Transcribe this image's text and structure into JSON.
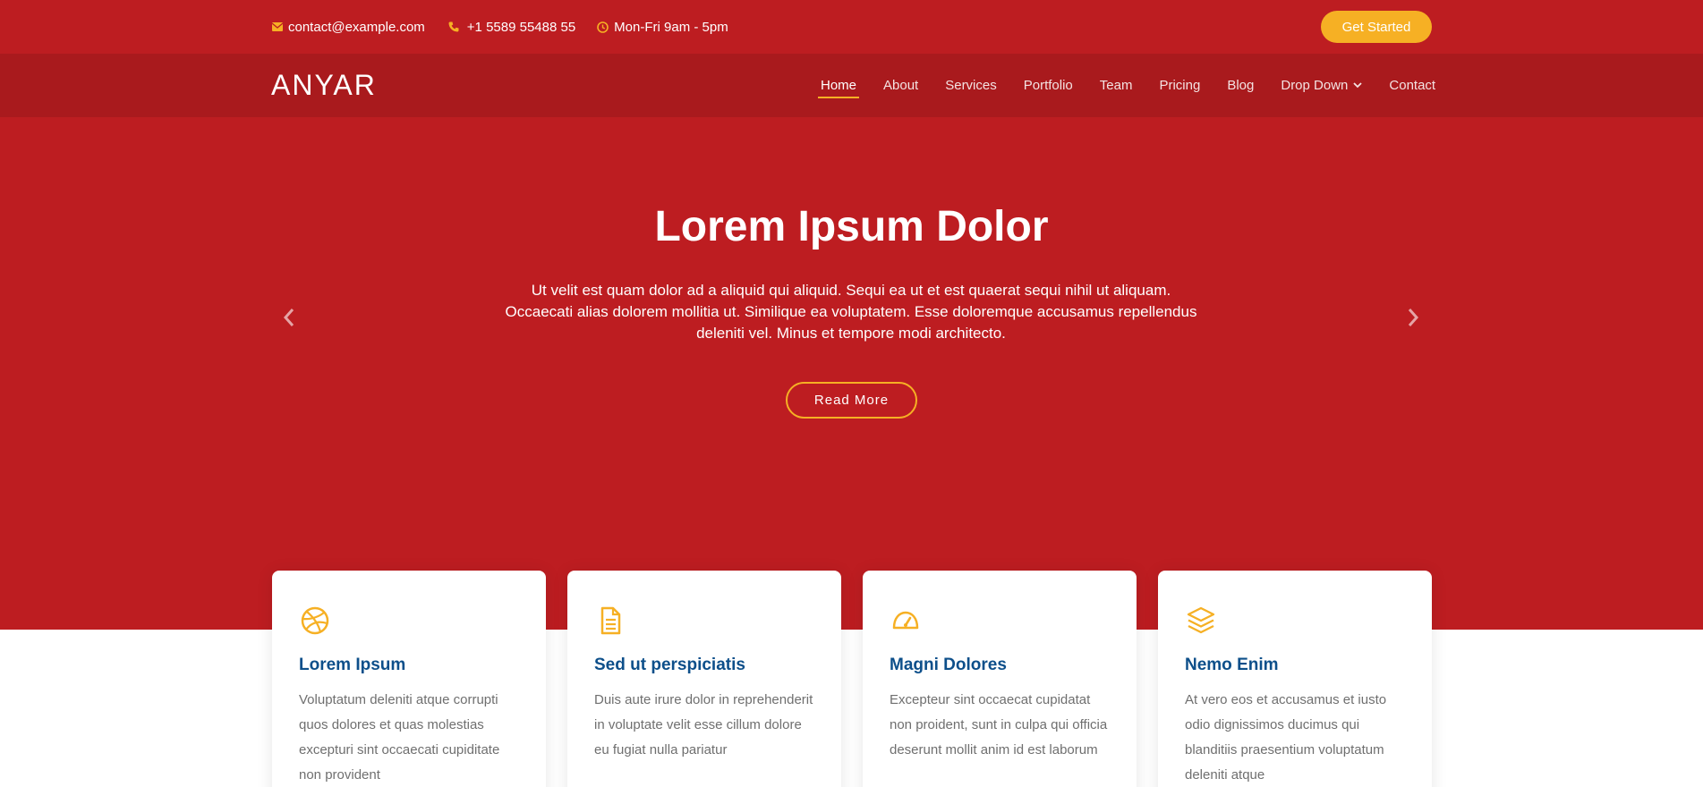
{
  "topbar": {
    "email": "contact@example.com",
    "phone": "+1 5589 55488 55",
    "hours": "Mon-Fri 9am - 5pm",
    "cta_label": "Get Started",
    "icons": [
      "envelope-icon",
      "phone-icon",
      "clock-icon"
    ]
  },
  "header": {
    "logo": "ANYAR",
    "nav": [
      {
        "label": "Home",
        "active": true
      },
      {
        "label": "About"
      },
      {
        "label": "Services"
      },
      {
        "label": "Portfolio"
      },
      {
        "label": "Team"
      },
      {
        "label": "Pricing"
      },
      {
        "label": "Blog"
      },
      {
        "label": "Drop Down",
        "has_dropdown": true
      },
      {
        "label": "Contact"
      }
    ]
  },
  "hero": {
    "title": "Lorem Ipsum Dolor",
    "text": "Ut velit est quam dolor ad a aliquid qui aliquid. Sequi ea ut et est quaerat sequi nihil ut aliquam. Occaecati alias dolorem mollitia ut. Similique ea voluptatem. Esse doloremque accusamus repellendus deleniti vel. Minus et tempore modi architecto.",
    "button_label": "Read More"
  },
  "cards": [
    {
      "icon": "dribbble-icon",
      "title": "Lorem Ipsum",
      "text": "Voluptatum deleniti atque corrupti quos dolores et quas molestias excepturi sint occaecati cupiditate non provident"
    },
    {
      "icon": "document-icon",
      "title": "Sed ut perspiciatis",
      "text": "Duis aute irure dolor in reprehenderit in voluptate velit esse cillum dolore eu fugiat nulla pariatur"
    },
    {
      "icon": "speedometer-icon",
      "title": "Magni Dolores",
      "text": "Excepteur sint occaecat cupidatat non proident, sunt in culpa qui officia deserunt mollit anim id est laborum"
    },
    {
      "icon": "layers-icon",
      "title": "Nemo Enim",
      "text": "At vero eos et accusamus et iusto odio dignissimos ducimus qui blanditiis praesentium voluptatum deleniti atque"
    }
  ],
  "colors": {
    "primary_red": "#bd1d21",
    "header_red": "#a91a1d",
    "accent_yellow": "#f6b024",
    "card_title_blue": "#0d4f8a"
  }
}
